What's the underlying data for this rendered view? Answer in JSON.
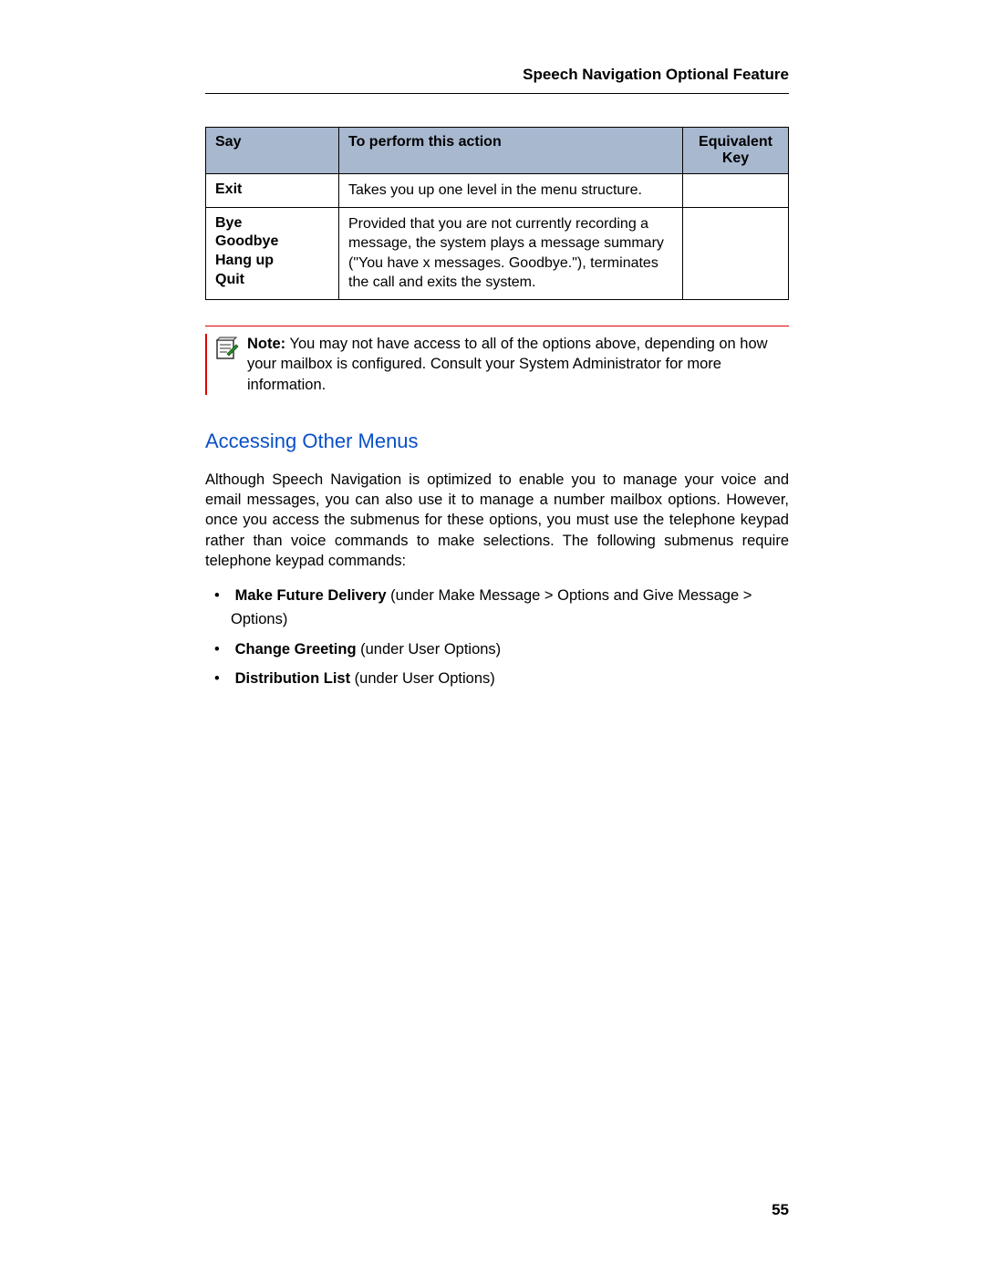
{
  "header": {
    "title": "Speech Navigation Optional Feature"
  },
  "table": {
    "headers": {
      "say": "Say",
      "action": "To perform this action",
      "key": "Equivalent Key"
    },
    "rows": [
      {
        "say": [
          "Exit"
        ],
        "action": "Takes you up one level in the menu structure.",
        "key": ""
      },
      {
        "say": [
          "Bye",
          "Goodbye",
          "Hang up",
          "Quit"
        ],
        "action": "Provided that you are not currently recording a message, the system plays a message summary (\"You have x messages. Goodbye.\"), terminates the call and exits the system.",
        "key": ""
      }
    ]
  },
  "note": {
    "label": "Note:",
    "text": "You may not have access to all of the options above, depending on how your mailbox is configured. Consult your System Administrator for more information."
  },
  "section": {
    "heading": "Accessing Other Menus"
  },
  "paragraph": "Although Speech Navigation is optimized to enable you to manage your voice and email messages, you can also use it to manage a number mailbox options. However, once you access the submenus for these options, you must use the telephone keypad rather than voice commands to make selections. The following submenus require telephone keypad commands:",
  "bullets": [
    {
      "bold": "Make Future Delivery",
      "rest": " (under Make Message > Options and Give Message > Options)"
    },
    {
      "bold": "Change Greeting",
      "rest": " (under User Options)"
    },
    {
      "bold": "Distribution List",
      "rest": " (under User Options)"
    }
  ],
  "page_number": "55"
}
